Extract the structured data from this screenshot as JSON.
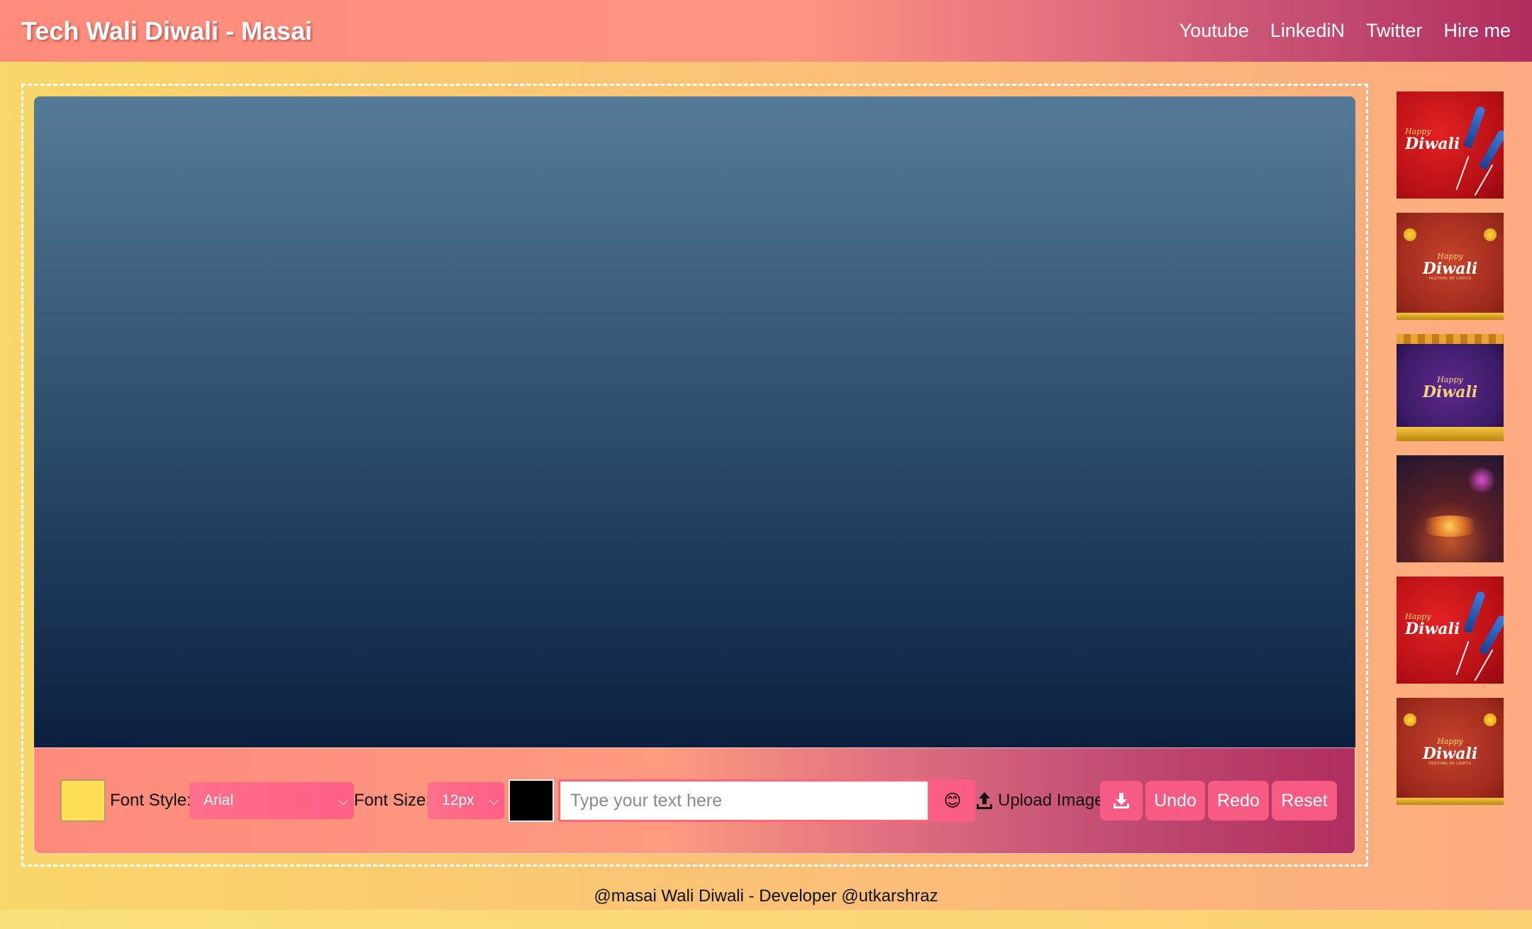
{
  "header": {
    "brand": "Tech Wali Diwali - Masai",
    "nav": [
      {
        "label": "Youtube"
      },
      {
        "label": "LinkediN"
      },
      {
        "label": "Twitter"
      },
      {
        "label": "Hire me"
      }
    ]
  },
  "toolbar": {
    "bg_color": "#ffdf55",
    "font_style_label": "Font Style:",
    "font_style_value": "Arial",
    "font_size_label": "Font Size:",
    "font_size_value": "12px",
    "text_color": "#000000",
    "text_placeholder": "Type your text here",
    "emoji_icon": "smiley-face",
    "upload_label": "Upload Image",
    "download_icon": "download-icon",
    "undo_label": "Undo",
    "redo_label": "Redo",
    "reset_label": "Reset"
  },
  "thumbnails": [
    {
      "title": "Diwali",
      "sub": "Happy",
      "style": "rockets"
    },
    {
      "title": "Diwali",
      "sub": "Happy",
      "caption": "FESTIVAL OF LIGHTS",
      "style": "lamps"
    },
    {
      "title": "Diwali",
      "sub": "Happy",
      "style": "garland"
    },
    {
      "style": "candles"
    },
    {
      "title": "Diwali",
      "sub": "Happy",
      "style": "rockets"
    },
    {
      "title": "Diwali",
      "sub": "Happy",
      "caption": "FESTIVAL OF LIGHTS",
      "style": "lamps"
    }
  ],
  "footer": {
    "text": "@masai Wali Diwali - Developer @utkarshraz"
  }
}
